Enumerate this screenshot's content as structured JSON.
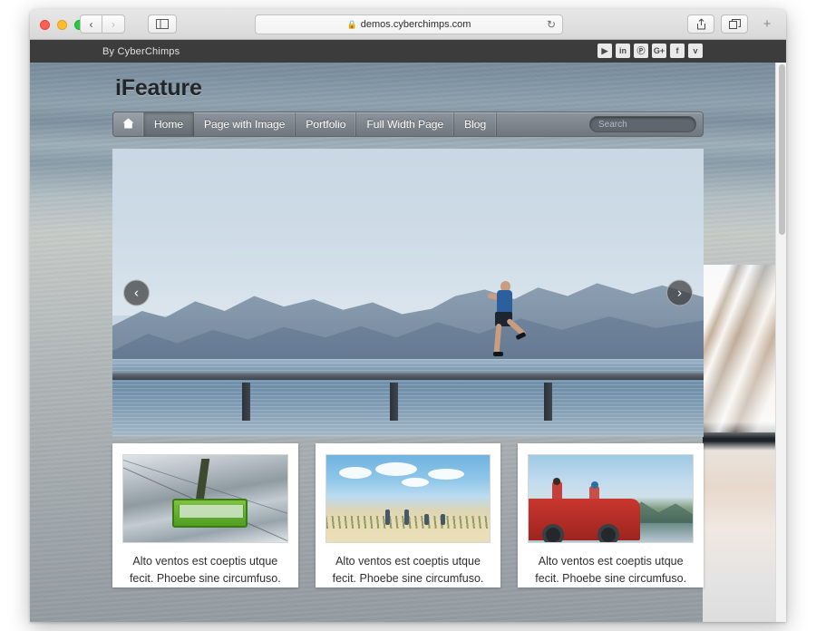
{
  "browser": {
    "url": "demos.cyberchimps.com",
    "lock_icon": "lock-icon",
    "reload_icon": "reload-icon",
    "back_icon": "chevron-left-icon",
    "forward_icon": "chevron-right-icon",
    "sidebar_icon": "sidebar-icon",
    "share_icon": "share-icon",
    "tabs_icon": "show-tabs-icon",
    "new_tab_icon": "plus-icon",
    "traffic_lights": [
      "close-red",
      "minimize-yellow",
      "zoom-green"
    ]
  },
  "topbar": {
    "byline": "By CyberChimps",
    "socials": [
      {
        "name": "youtube",
        "glyph": "▶"
      },
      {
        "name": "linkedin",
        "glyph": "in"
      },
      {
        "name": "pinterest",
        "glyph": "Ⓟ"
      },
      {
        "name": "googleplus",
        "glyph": "G+"
      },
      {
        "name": "facebook",
        "glyph": "f"
      },
      {
        "name": "twitter",
        "glyph": "ᴠ"
      }
    ]
  },
  "site": {
    "title": "iFeature"
  },
  "nav": {
    "home_icon": "⌂",
    "items": [
      {
        "label": "Home",
        "active": true
      },
      {
        "label": "Page with Image",
        "active": false
      },
      {
        "label": "Portfolio",
        "active": false
      },
      {
        "label": "Full Width Page",
        "active": false
      },
      {
        "label": "Blog",
        "active": false
      }
    ]
  },
  "search": {
    "placeholder": "Search",
    "value": ""
  },
  "slider": {
    "prev_label": "‹",
    "next_label": "›",
    "slide_alt": "Runner on a pier beside a lake with mountains"
  },
  "cards": [
    {
      "image_alt": "Green cable car above snowy mountains",
      "caption": "Alto ventos est coeptis utque fecit. Phoebe sine circumfuso."
    },
    {
      "image_alt": "People walking on sand dunes under blue sky",
      "caption": "Alto ventos est coeptis utque fecit. Phoebe sine circumfuso."
    },
    {
      "image_alt": "Two people sitting on a red jeep with mountains behind",
      "caption": "Alto ventos est coeptis utque fecit. Phoebe sine circumfuso."
    }
  ],
  "colors": {
    "topbar_bg": "#3c3c3c",
    "nav_bg": "#7b828a",
    "card_bg": "#ffffff",
    "text_dark": "#2e2e2e",
    "accent_green": "#5aa82a",
    "accent_red": "#c9372f"
  }
}
